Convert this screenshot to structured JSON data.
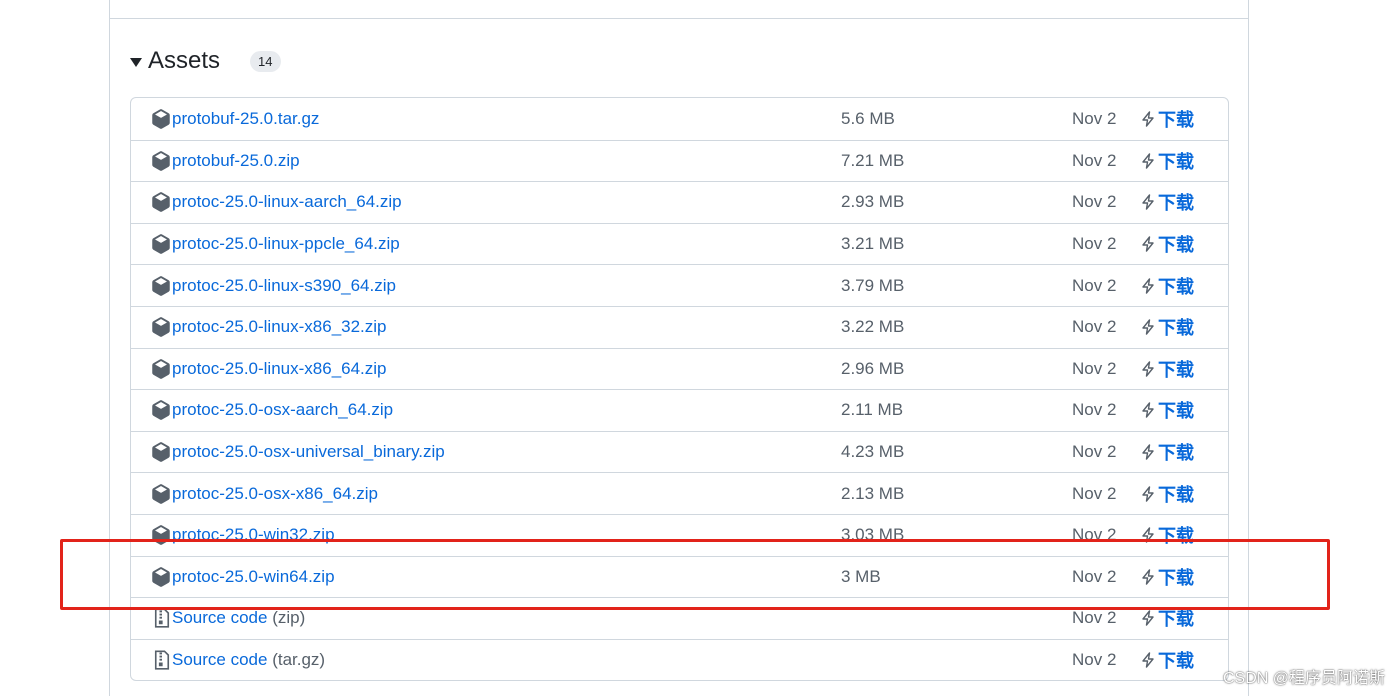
{
  "assets": {
    "title": "Assets",
    "count": "14",
    "download_label": "下载",
    "files": [
      {
        "name": "protobuf-25.0.tar.gz",
        "size": "5.6 MB",
        "date": "Nov 2"
      },
      {
        "name": "protobuf-25.0.zip",
        "size": "7.21 MB",
        "date": "Nov 2"
      },
      {
        "name": "protoc-25.0-linux-aarch_64.zip",
        "size": "2.93 MB",
        "date": "Nov 2"
      },
      {
        "name": "protoc-25.0-linux-ppcle_64.zip",
        "size": "3.21 MB",
        "date": "Nov 2"
      },
      {
        "name": "protoc-25.0-linux-s390_64.zip",
        "size": "3.79 MB",
        "date": "Nov 2"
      },
      {
        "name": "protoc-25.0-linux-x86_32.zip",
        "size": "3.22 MB",
        "date": "Nov 2"
      },
      {
        "name": "protoc-25.0-linux-x86_64.zip",
        "size": "2.96 MB",
        "date": "Nov 2"
      },
      {
        "name": "protoc-25.0-osx-aarch_64.zip",
        "size": "2.11 MB",
        "date": "Nov 2"
      },
      {
        "name": "protoc-25.0-osx-universal_binary.zip",
        "size": "4.23 MB",
        "date": "Nov 2"
      },
      {
        "name": "protoc-25.0-osx-x86_64.zip",
        "size": "2.13 MB",
        "date": "Nov 2"
      },
      {
        "name": "protoc-25.0-win32.zip",
        "size": "3.03 MB",
        "date": "Nov 2"
      },
      {
        "name": "protoc-25.0-win64.zip",
        "size": "3 MB",
        "date": "Nov 2"
      }
    ],
    "sources": [
      {
        "name": "Source code",
        "suffix": "(zip)",
        "date": "Nov 2"
      },
      {
        "name": "Source code",
        "suffix": "(tar.gz)",
        "date": "Nov 2"
      }
    ]
  },
  "icons": {
    "package": "package-icon",
    "source": "file-zip-icon",
    "download": "zap-icon",
    "caret": "triangle-down-icon"
  },
  "colors": {
    "link": "#0969da",
    "muted": "#57606a",
    "border": "#d0d7de",
    "highlight": "#e2231a"
  },
  "watermark": "CSDN @程序员阿诺斯"
}
